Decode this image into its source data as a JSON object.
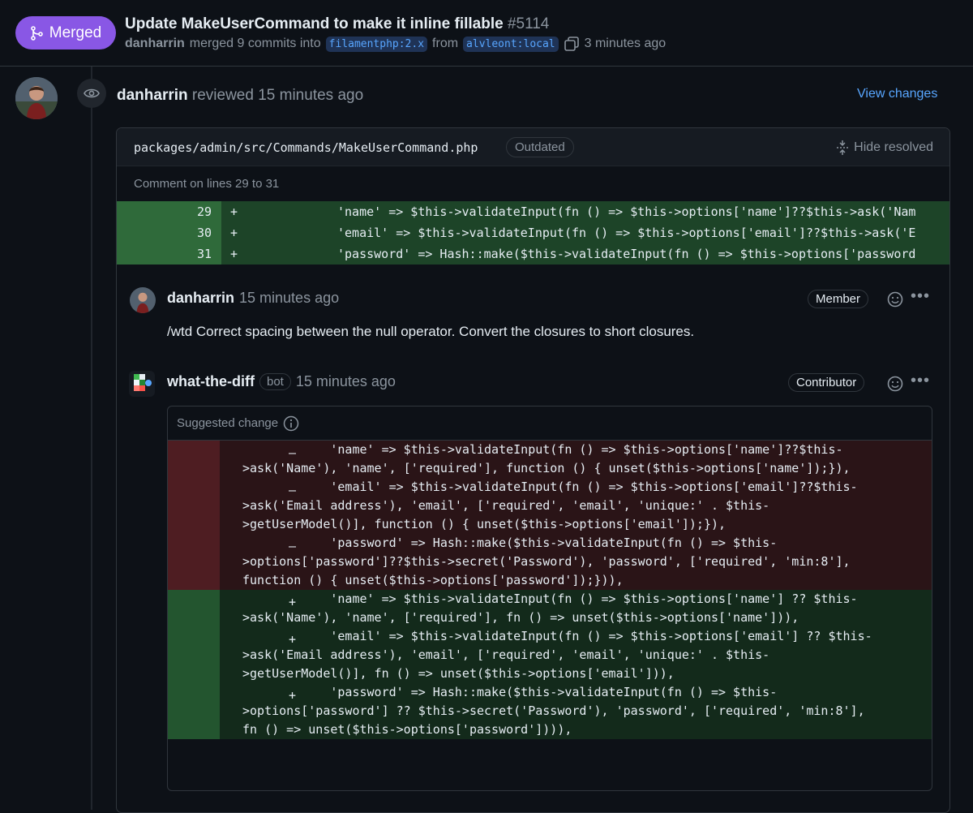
{
  "pr": {
    "state": "Merged",
    "title": "Update MakeUserCommand to make it inline fillable",
    "number": "#5114",
    "author": "danharrin",
    "action": "merged 9 commits into",
    "base_branch": "filamentphp:2.x",
    "from_word": "from",
    "head_branch": "alvleont:local",
    "time": "3 minutes ago"
  },
  "review": {
    "author": "danharrin",
    "action": "reviewed 15 minutes ago",
    "view_changes": "View changes",
    "file_path": "packages/admin/src/Commands/MakeUserCommand.php",
    "outdated_label": "Outdated",
    "hide_resolved": "Hide resolved",
    "comment_lines": "Comment on lines 29 to 31",
    "snippet": [
      {
        "line": "29",
        "sign": "+",
        "code": "'name' => $this->validateInput(fn () => $this->options['name']??$this->ask('Nam"
      },
      {
        "line": "30",
        "sign": "+",
        "code": "'email' => $this->validateInput(fn () => $this->options['email']??$this->ask('E"
      },
      {
        "line": "31",
        "sign": "+",
        "code": "'password' => Hash::make($this->validateInput(fn () => $this->options['password"
      }
    ]
  },
  "comments": [
    {
      "author": "danharrin",
      "time": "15 minutes ago",
      "role": "Member",
      "body": "/wtd Correct spacing between the null operator. Convert the closures to short closures."
    },
    {
      "author": "what-the-diff",
      "bot": "bot",
      "time": "15 minutes ago",
      "role": "Contributor"
    }
  ],
  "suggestion": {
    "title": "Suggested change",
    "removed": [
      [
        "            'name' => $this->validateInput(fn () => $this->options['name']??$this-",
        ">ask('Name'), 'name', ['required'], function () { unset($this->options['name']);}),"
      ],
      [
        "            'email' => $this->validateInput(fn () => $this->options['email']??$this-",
        ">ask('Email address'), 'email', ['required', 'email', 'unique:' . $this-",
        ">getUserModel()], function () { unset($this->options['email']);}),"
      ],
      [
        "            'password' => Hash::make($this->validateInput(fn () => $this-",
        ">options['password']??$this->secret('Password'), 'password', ['required', 'min:8'],",
        "function () { unset($this->options['password']);})),"
      ]
    ],
    "added": [
      [
        "            'name' => $this->validateInput(fn () => $this->options['name'] ?? $this-",
        ">ask('Name'), 'name', ['required'], fn () => unset($this->options['name'])),"
      ],
      [
        "            'email' => $this->validateInput(fn () => $this->options['email'] ?? $this-",
        ">ask('Email address'), 'email', ['required', 'email', 'unique:' . $this-",
        ">getUserModel()], fn () => unset($this->options['email'])),"
      ],
      [
        "            'password' => Hash::make($this->validateInput(fn () => $this-",
        ">options['password'] ?? $this->secret('Password'), 'password', ['required', 'min:8'],",
        "fn () => unset($this->options['password']))),"
      ]
    ]
  },
  "colors": {
    "merged": "#8957e5",
    "link": "#58a6ff",
    "add": "#1d4428",
    "del": "#4e1d22"
  },
  "icons": [
    "git-merge-icon",
    "copy-icon",
    "eye-icon",
    "unfold-icon",
    "info-icon",
    "smiley-icon",
    "kebab-icon"
  ]
}
